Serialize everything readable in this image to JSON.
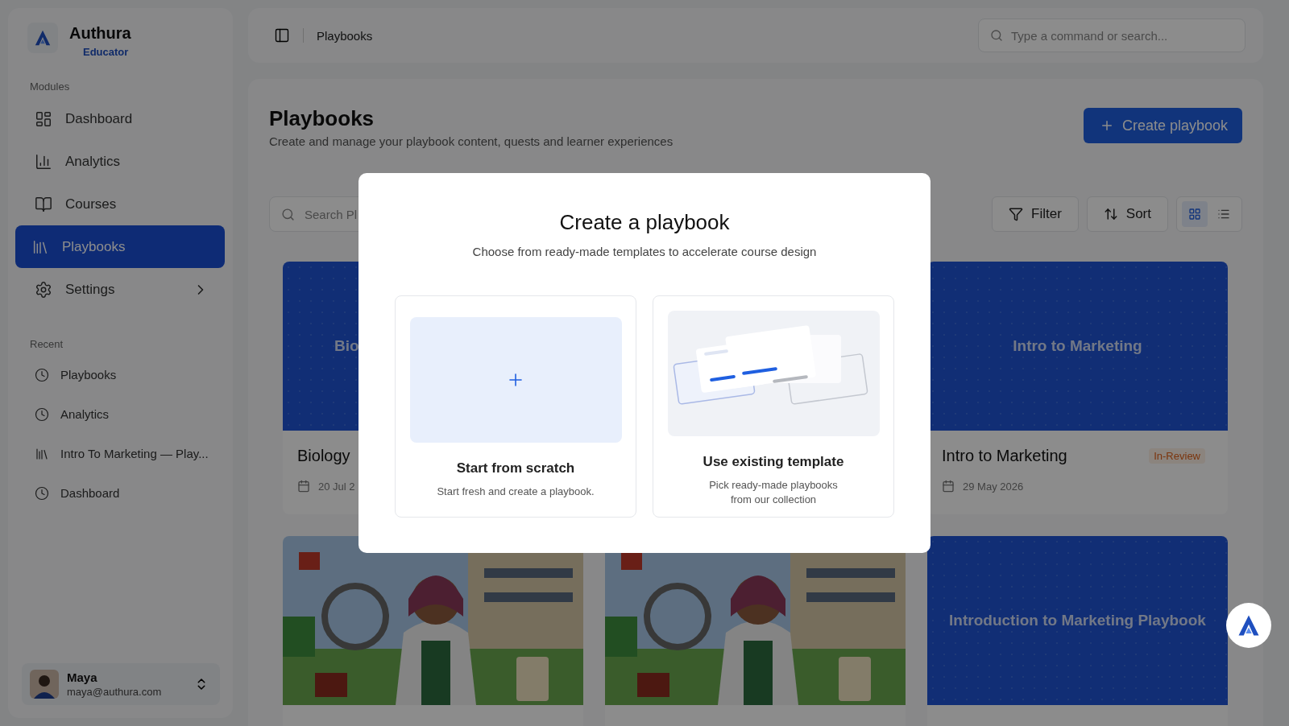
{
  "brand": {
    "name": "Authura",
    "role": "Educator"
  },
  "sidebar": {
    "sections": [
      {
        "heading": "Modules",
        "items": [
          {
            "label": "Dashboard",
            "kind": "dashboard",
            "selected": false
          },
          {
            "label": "Analytics",
            "kind": "chart",
            "selected": false
          },
          {
            "label": "Courses",
            "kind": "book",
            "selected": false
          },
          {
            "label": "Playbooks",
            "kind": "library",
            "selected": true
          },
          {
            "label": "Settings",
            "kind": "gear",
            "selected": false,
            "submenu": true
          }
        ]
      },
      {
        "heading": "Recent",
        "items": [
          {
            "label": "Playbooks",
            "kind": "clock",
            "selected": false
          },
          {
            "label": "Analytics",
            "kind": "clock",
            "selected": false
          },
          {
            "label": "Intro To Marketing — Play...",
            "kind": "library",
            "selected": false
          },
          {
            "label": "Dashboard",
            "kind": "clock",
            "selected": false
          }
        ]
      }
    ]
  },
  "user": {
    "name": "Maya",
    "email": "maya@authura.com"
  },
  "topbar": {
    "breadcrumb": "Playbooks",
    "search": {
      "placeholder": "Type a command or search..."
    }
  },
  "page": {
    "title": "Playbooks",
    "subtitle": "Create and manage your playbook content, quests and learner experiences",
    "create_button": "Create playbook"
  },
  "toolbar": {
    "search": {
      "placeholder": "Search Pl"
    },
    "filter": "Filter",
    "sort": "Sort",
    "views": [
      {
        "kind": "grid",
        "selected": true
      },
      {
        "kind": "list",
        "selected": false
      }
    ]
  },
  "cards": [
    {
      "kind": "banner",
      "banner_title": "Bio",
      "title": "Biology",
      "date": "20 Jul 2"
    },
    {
      "kind": "banner",
      "banner_title": "Intro to Marketing",
      "title": "Intro to Marketing",
      "status": "In-Review",
      "date": "29 May 2026"
    },
    {
      "kind": "picture"
    },
    {
      "kind": "picture"
    },
    {
      "kind": "banner",
      "banner_title": "Introduction to Marketing Playbook"
    }
  ],
  "modal": {
    "title": "Create a playbook",
    "subtitle": "Choose from ready-made templates to accelerate course design",
    "options": [
      {
        "kind": "scratch",
        "title": "Start from scratch",
        "description": "Start fresh and create a playbook."
      },
      {
        "kind": "template",
        "title": "Use existing template",
        "description": "Pick ready-made playbooks from our collection"
      }
    ]
  }
}
